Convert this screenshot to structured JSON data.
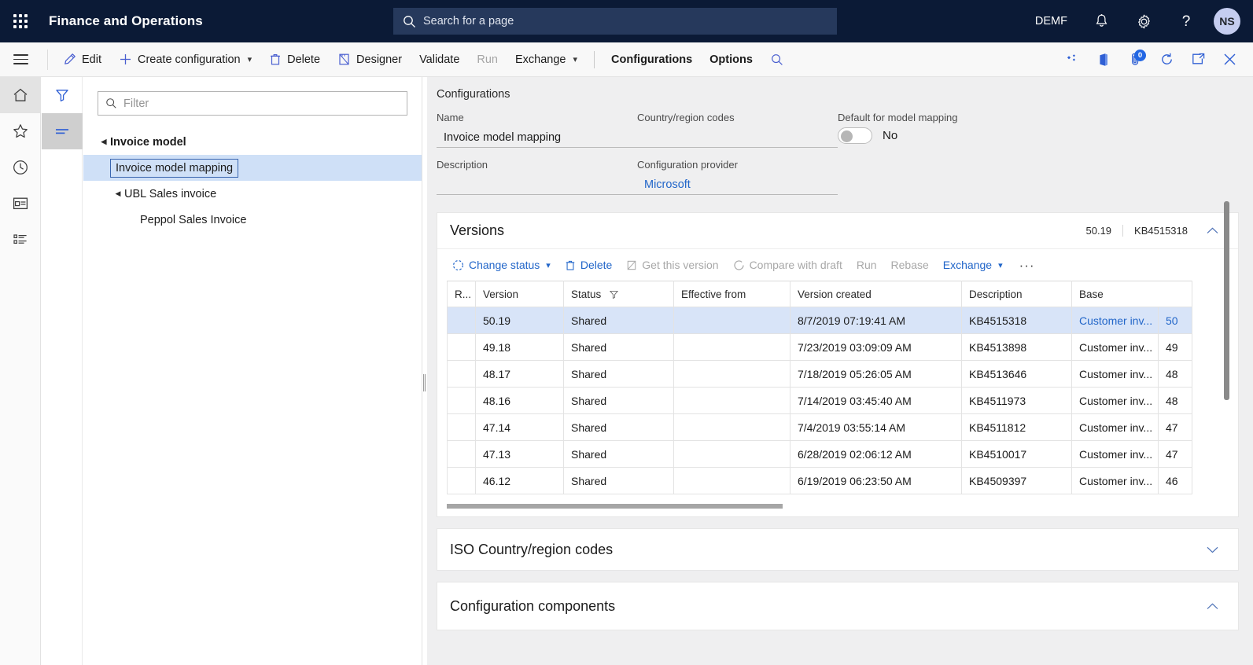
{
  "topbar": {
    "app_title": "Finance and Operations",
    "search_placeholder": "Search for a page",
    "company": "DEMF",
    "avatar_initials": "NS",
    "icons": [
      "waffle-icon",
      "search-icon",
      "notifications-icon",
      "settings-icon",
      "help-icon"
    ]
  },
  "commandbar": {
    "buttons": [
      {
        "label": "Edit",
        "icon": "pencil-icon",
        "disabled": false,
        "caret": false,
        "strong": false
      },
      {
        "label": "Create configuration",
        "icon": "plus-icon",
        "disabled": false,
        "caret": true,
        "strong": false
      },
      {
        "label": "Delete",
        "icon": "trash-icon",
        "disabled": false,
        "caret": false,
        "strong": false
      },
      {
        "label": "Designer",
        "icon": "designer-icon",
        "disabled": false,
        "caret": false,
        "strong": false
      },
      {
        "label": "Validate",
        "icon": "",
        "disabled": false,
        "caret": false,
        "strong": false
      },
      {
        "label": "Run",
        "icon": "",
        "disabled": true,
        "caret": false,
        "strong": false
      },
      {
        "label": "Exchange",
        "icon": "",
        "disabled": false,
        "caret": true,
        "strong": false
      }
    ],
    "tabs": [
      {
        "label": "Configurations",
        "selected": true
      },
      {
        "label": "Options",
        "selected": false
      }
    ],
    "right_icons": [
      "search-icon",
      "personalize-icon",
      "office-app-icon",
      "attachments-icon",
      "refresh-icon",
      "popout-icon",
      "close-icon"
    ],
    "attachments_count": "0"
  },
  "rail": {
    "items": [
      "hamburger-icon",
      "home-icon",
      "favorites-star-icon",
      "recent-clock-icon",
      "workspaces-icon",
      "modules-list-icon"
    ],
    "active_index": 1
  },
  "treepanel": {
    "tools": [
      "filter-funnel-icon",
      "list-lines-icon"
    ],
    "active_tool_index": 1,
    "filter_placeholder": "Filter",
    "nodes": [
      {
        "label": "Invoice model",
        "level": 0,
        "expanded": true,
        "selected": false
      },
      {
        "label": "Invoice model mapping",
        "level": 1,
        "expanded": null,
        "selected": true
      },
      {
        "label": "UBL Sales invoice",
        "level": 1,
        "expanded": true,
        "selected": false
      },
      {
        "label": "Peppol Sales Invoice",
        "level": 2,
        "expanded": null,
        "selected": false
      }
    ]
  },
  "form": {
    "heading": "Configurations",
    "fields": {
      "name_label": "Name",
      "name_value": "Invoice model mapping",
      "country_label": "Country/region codes",
      "country_value": "",
      "default_label": "Default for model mapping",
      "default_value": "No",
      "description_label": "Description",
      "description_value": "",
      "provider_label": "Configuration provider",
      "provider_value": "Microsoft"
    }
  },
  "versions": {
    "title": "Versions",
    "summary_version": "50.19",
    "summary_kb": "KB4515318",
    "collapse_icon": "chevron-up-icon",
    "toolbar": [
      {
        "label": "Change status",
        "icon": "status-circle-icon",
        "disabled": false,
        "caret": true,
        "dark": false
      },
      {
        "label": "Delete",
        "icon": "trash-icon",
        "disabled": false,
        "caret": false,
        "dark": false
      },
      {
        "label": "Get this version",
        "icon": "get-version-icon",
        "disabled": true,
        "caret": false,
        "dark": false
      },
      {
        "label": "Compare with draft",
        "icon": "compare-icon",
        "disabled": true,
        "caret": false,
        "dark": false
      },
      {
        "label": "Run",
        "icon": "",
        "disabled": true,
        "caret": false,
        "dark": false
      },
      {
        "label": "Rebase",
        "icon": "",
        "disabled": true,
        "caret": false,
        "dark": false
      },
      {
        "label": "Exchange",
        "icon": "",
        "disabled": false,
        "caret": true,
        "dark": false
      }
    ],
    "overflow_label": "···",
    "columns": [
      "R...",
      "Version",
      "Status",
      "Effective from",
      "Version created",
      "Description",
      "Base",
      ""
    ],
    "status_has_filter": true,
    "rows": [
      {
        "r": "",
        "version": "50.19",
        "status": "Shared",
        "effective_from": "",
        "created": "8/7/2019 07:19:41 AM",
        "description": "KB4515318",
        "base": "Customer inv...",
        "num": "50",
        "selected": true
      },
      {
        "r": "",
        "version": "49.18",
        "status": "Shared",
        "effective_from": "",
        "created": "7/23/2019 03:09:09 AM",
        "description": "KB4513898",
        "base": "Customer inv...",
        "num": "49",
        "selected": false
      },
      {
        "r": "",
        "version": "48.17",
        "status": "Shared",
        "effective_from": "",
        "created": "7/18/2019 05:26:05 AM",
        "description": "KB4513646",
        "base": "Customer inv...",
        "num": "48",
        "selected": false
      },
      {
        "r": "",
        "version": "48.16",
        "status": "Shared",
        "effective_from": "",
        "created": "7/14/2019 03:45:40 AM",
        "description": "KB4511973",
        "base": "Customer inv...",
        "num": "48",
        "selected": false
      },
      {
        "r": "",
        "version": "47.14",
        "status": "Shared",
        "effective_from": "",
        "created": "7/4/2019 03:55:14 AM",
        "description": "KB4511812",
        "base": "Customer inv...",
        "num": "47",
        "selected": false
      },
      {
        "r": "",
        "version": "47.13",
        "status": "Shared",
        "effective_from": "",
        "created": "6/28/2019 02:06:12 AM",
        "description": "KB4510017",
        "base": "Customer inv...",
        "num": "47",
        "selected": false
      },
      {
        "r": "",
        "version": "46.12",
        "status": "Shared",
        "effective_from": "",
        "created": "6/19/2019 06:23:50 AM",
        "description": "KB4509397",
        "base": "Customer inv...",
        "num": "46",
        "selected": false
      }
    ]
  },
  "sections": [
    {
      "title": "ISO Country/region codes",
      "expanded": false,
      "chevron": "chevron-down-icon"
    },
    {
      "title": "Configuration components",
      "expanded": true,
      "chevron": "chevron-up-icon"
    }
  ],
  "colors": {
    "header_bg": "#0b1a36",
    "search_bg": "#26395c",
    "accent_link": "#2266c9",
    "selection_bg": "#d8e4f8",
    "tree_selection_bg": "#cfe0f7",
    "badge_bg": "#2266e3",
    "canvas_bg": "#efeff0"
  }
}
